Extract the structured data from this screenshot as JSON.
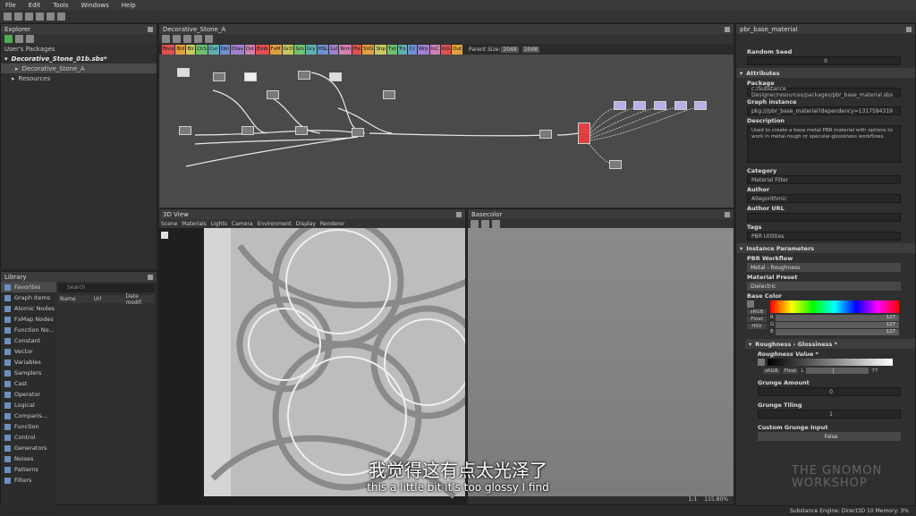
{
  "menu": [
    "File",
    "Edit",
    "Tools",
    "Windows",
    "Help"
  ],
  "explorer": {
    "title": "Explorer",
    "section": "User's Packages",
    "package": "Decorative_Stone_01b.sbs*",
    "graph": "Decorative_Stone_A",
    "resources": "Resources"
  },
  "library": {
    "title": "Library",
    "search_placeholder": "Search",
    "cols": [
      "Name",
      "Url",
      "Date modif."
    ],
    "categories": [
      "Favorites",
      "Graph Items",
      "Atomic Nodes",
      "FxMap Nodes",
      "Function No...",
      "Constant",
      "Vector",
      "Variables",
      "Samplers",
      "Cast",
      "Operator",
      "Logical",
      "Comparis...",
      "Function",
      "Control",
      "Generators",
      "Noises",
      "Patterns",
      "Filters"
    ]
  },
  "graph": {
    "title": "Decorative_Stone_A",
    "parent_size_label": "Parent Size:",
    "parent_size": "2048",
    "size2": "2048",
    "node_buttons": [
      "Bnrs",
      "Bld",
      "Blr",
      "ChS",
      "Cur",
      "Dbl",
      "Dtav",
      "Dst",
      "Emb",
      "FxM",
      "GrD",
      "Grs",
      "Gry",
      "HSL",
      "Lvl",
      "Nrm",
      "Pix",
      "SVG",
      "Shp",
      "Txt",
      "Trs",
      "Cr",
      "Wrp",
      "InC",
      "InG",
      "Out"
    ]
  },
  "view3d": {
    "title": "3D View",
    "menu": [
      "Scene",
      "Materials",
      "Lights",
      "Camera",
      "Environment",
      "Display",
      "Renderer"
    ]
  },
  "view2d": {
    "title": "Basecolor",
    "zoom": "115.80%",
    "ratio": "1:1"
  },
  "props": {
    "title": "pbr_base_material",
    "random_seed": "Random Seed",
    "random_seed_value": "0",
    "attributes": "Attributes",
    "package_label": "Package",
    "package": "c:/Substance Designer/resources/packages/pbr_base_material.sbs",
    "graph_instance_label": "Graph instance",
    "graph_instance": "pkg:///pbr_base_material?dependency=1317584319",
    "description_label": "Description",
    "description": "Used to create a base metal PBR material with options to work in metal-rough or specular-glossiness workflows.",
    "category_label": "Category",
    "category": "Material Filter",
    "author_label": "Author",
    "author": "Allegorithmic",
    "author_url_label": "Author URL",
    "tags_label": "Tags",
    "tags": "PBR Utilities",
    "instance_params": "Instance Parameters",
    "pbr_workflow_label": "PBR Workflow",
    "pbr_workflow": "Metal - Roughness",
    "material_preset_label": "Material Preset",
    "material_preset": "Dielectric",
    "base_color_label": "Base Color",
    "srgb": "sRGB",
    "float": "Float",
    "hsv": "HSV",
    "r": "R",
    "g": "G",
    "b": "B",
    "r_val": "127",
    "g_val": "127",
    "b_val": "127",
    "rough_section": "Roughness - Glossiness *",
    "rough_label": "Roughness Value *",
    "l_label": "L",
    "l_val": "77",
    "grunge_amount_label": "Grunge Amount",
    "grunge_amount": "0",
    "grunge_tiling_label": "Grunge Tiling",
    "grunge_tiling": "1",
    "custom_grunge_label": "Custom Grunge Input",
    "custom_grunge": "False"
  },
  "subtitle": {
    "zh": "我觉得这有点太光泽了",
    "en": "this a little bit it's too glossy I find"
  },
  "status": "Substance Engine: Direct3D 10  Memory: 3%",
  "watermark": "THE GNOMON WORKSHOP"
}
